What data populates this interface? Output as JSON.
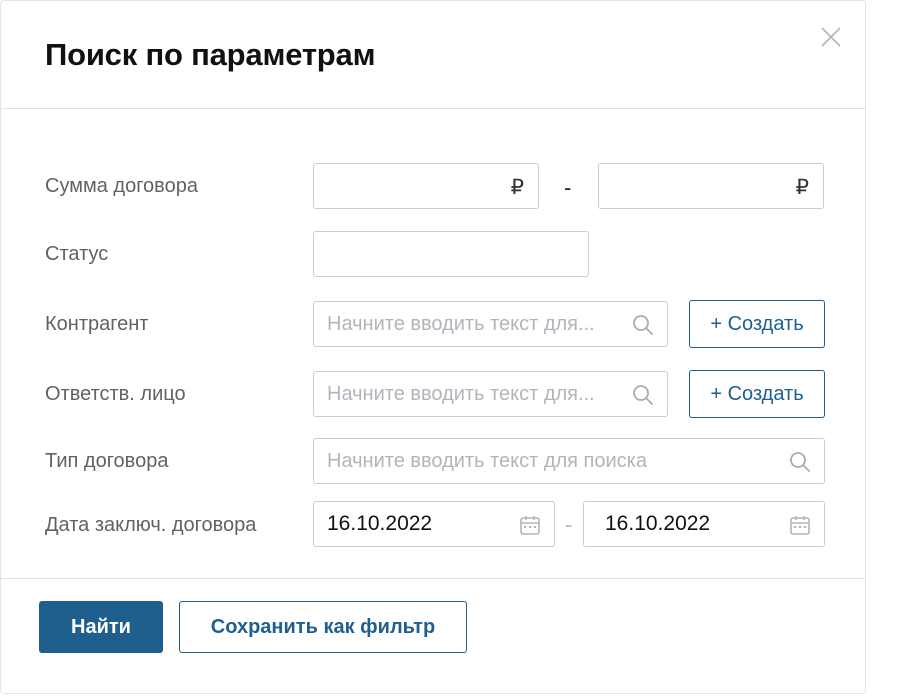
{
  "dialog": {
    "title": "Поиск по параметрам",
    "close_icon": "close-icon"
  },
  "form": {
    "amount": {
      "label": "Сумма договора",
      "from_value": "",
      "to_value": "",
      "currency": "₽",
      "separator": "-"
    },
    "status": {
      "label": "Статус",
      "value": ""
    },
    "counterparty": {
      "label": "Контрагент",
      "placeholder": "Начните вводить текст для...",
      "value": "",
      "icon": "search-icon",
      "create_label": "+ Создать"
    },
    "responsible": {
      "label": "Ответств. лицо",
      "placeholder": "Начните вводить текст для...",
      "value": "",
      "icon": "search-icon",
      "create_label": "+ Создать"
    },
    "contract_type": {
      "label": "Тип договора",
      "placeholder": "Начните вводить текст для поиска",
      "value": "",
      "icon": "search-icon"
    },
    "date": {
      "label": "Дата заключ. договора",
      "from_value": "16.10.2022",
      "to_value": "16.10.2022",
      "icon": "calendar-icon",
      "separator": "-"
    }
  },
  "footer": {
    "search_label": "Найти",
    "save_filter_label": "Сохранить как фильтр"
  },
  "colors": {
    "accent": "#1f5f8e",
    "label_text": "#5f6368",
    "placeholder": "#b1b5bb",
    "border": "#c9ccd1"
  }
}
